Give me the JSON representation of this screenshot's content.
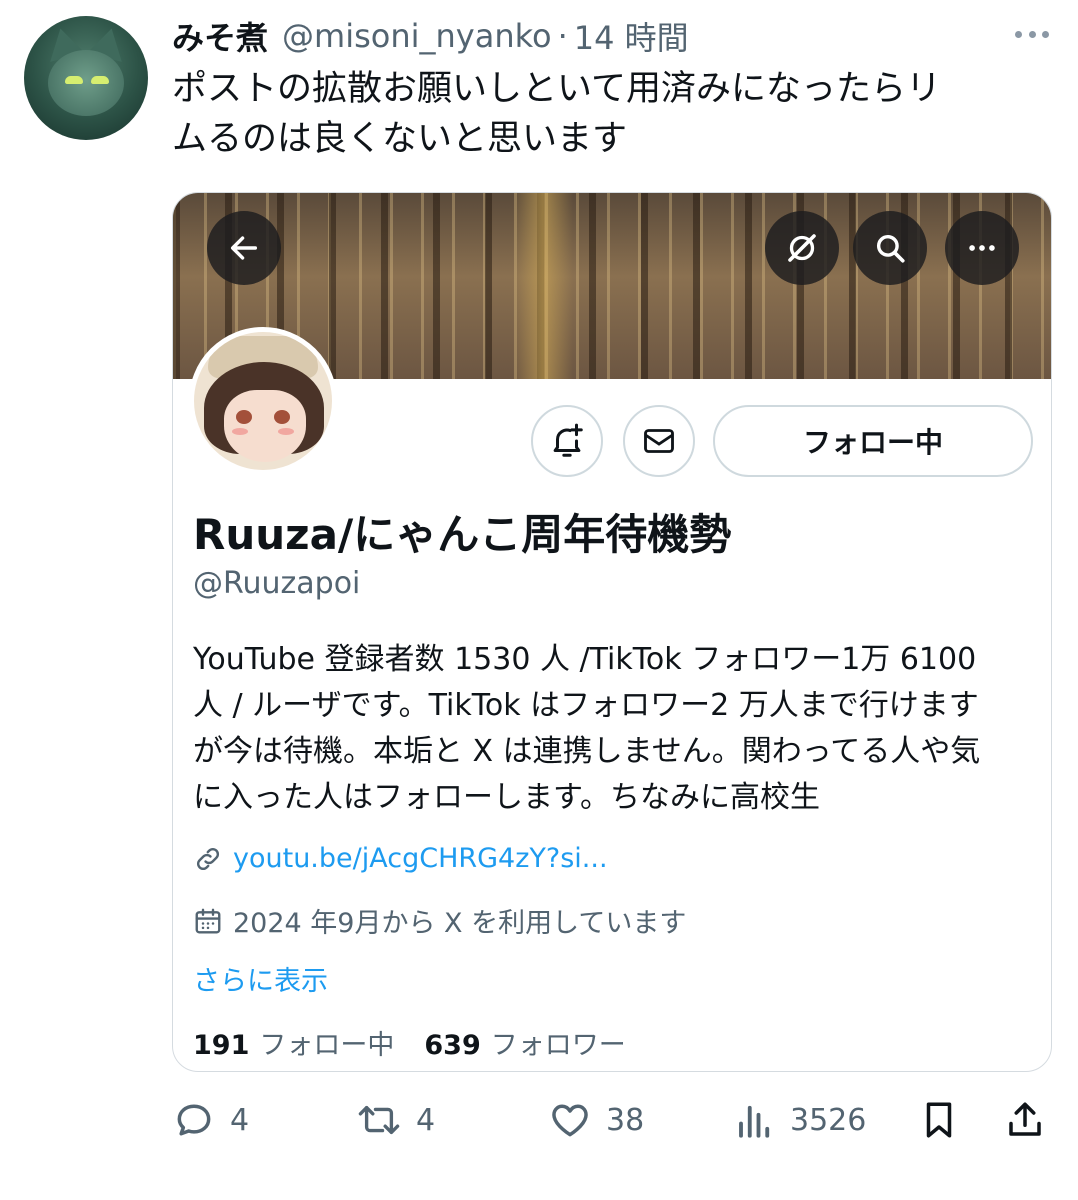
{
  "tweet": {
    "author_name": "みそ煮",
    "author_handle": "@misoni_nyanko",
    "separator": "·",
    "time": "14 時間",
    "text": "ポストの拡散お願いしといて用済みになったらリ\nムるのは良くないと思います"
  },
  "profile_card": {
    "display_name": "Ruuza/にゃんこ周年待機勢",
    "handle": "@Ruuzapoi",
    "follow_button_label": "フォロー中",
    "bio": "YouTube 登録者数 1530 人 /TikTok フォロワー1万 6100\n人 / ルーザです。TikTok はフォロワー2 万人まで行けます\nが今は待機。本垢と X は連携しません。関わってる人や気\nに入った人はフォローします。ちなみに高校生",
    "link_text": "youtu.be/jAcgCHRG4zY?si...",
    "joined_text": "2024 年9月から X を利用しています",
    "show_more": "さらに表示",
    "following_count": "191",
    "following_label": "フォロー中",
    "followers_count": "639",
    "followers_label": "フォロワー"
  },
  "actions": {
    "replies": "4",
    "reposts": "4",
    "likes": "38",
    "views": "3526"
  },
  "colors": {
    "text": "#0f1419",
    "secondary": "#536471",
    "link": "#1d9bf0",
    "border": "#cfd9de"
  },
  "icons": [
    "more-horizontal-icon",
    "back-arrow-icon",
    "grok-icon",
    "search-icon",
    "more-circle-icon",
    "bell-plus-icon",
    "mail-icon",
    "link-icon",
    "calendar-icon",
    "reply-icon",
    "retweet-icon",
    "like-icon",
    "views-icon",
    "bookmark-icon",
    "share-icon"
  ]
}
